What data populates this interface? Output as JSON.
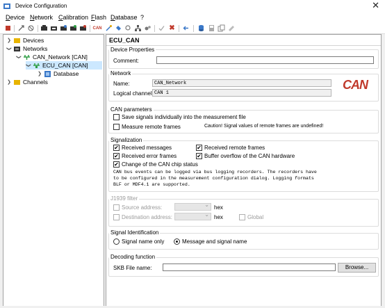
{
  "window": {
    "title": "Device Configuration",
    "close_glyph": "✕"
  },
  "menu": [
    "Device",
    "Network",
    "Calibration",
    "Flash",
    "Database",
    "?"
  ],
  "toolbar": {
    "icons": [
      "power-icon",
      "connect-icon",
      "disconnect-icon",
      "network-add-icon",
      "network-remove-icon",
      "bus-icon",
      "bus-add-icon",
      "bus-remove-icon",
      "can-icon",
      "wizard-icon",
      "ecu-icon",
      "search-icon",
      "tree-icon",
      "settings-icon",
      "check-icon",
      "delete-icon",
      "import-icon",
      "database-icon",
      "save-icon",
      "copy-icon",
      "help-icon"
    ],
    "can_label": "CAN"
  },
  "tree": {
    "devices": "Devices",
    "networks": "Networks",
    "can_network": "CAN_Network [CAN]",
    "ecu_can": "ECU_CAN [CAN]",
    "database": "Database",
    "channels": "Channels"
  },
  "panel": {
    "title": "ECU_CAN",
    "device_properties": {
      "label": "Device Properties",
      "comment_label": "Comment:",
      "comment_value": ""
    },
    "network": {
      "label": "Network",
      "name_label": "Name:",
      "name_value": "CAN_Network",
      "channel_label": "Logical channel:",
      "channel_value": "CAN 1",
      "logo_text": "CAN"
    },
    "can_parameters": {
      "label": "CAN parameters",
      "save_signals": "Save signals individually into the measurement file",
      "measure_remote": "Measure remote frames",
      "caution": "Caution! Signal values of remote frames are undefined!"
    },
    "signalization": {
      "label": "Signalization",
      "received_messages": "Received messages",
      "received_remote": "Received remote frames",
      "received_error": "Received error frames",
      "buffer_overflow": "Buffer overflow of the CAN hardware",
      "chip_status": "Change of the CAN chip status",
      "note_line1": "CAN bus events can be logged via bus logging recorders. The recorders have",
      "note_line2": "to be configured in the measurement configuration dialog. Logging formats",
      "note_line3": "BLF or MDF4.1 are supported."
    },
    "j1939": {
      "label": "J1939 filter",
      "source": "Source address:",
      "destination": "Destination address:",
      "hex1": "hex",
      "hex2": "hex",
      "global": "Global"
    },
    "signal_identification": {
      "label": "Signal Identification",
      "signal_only": "Signal name only",
      "message_and_signal": "Message and signal name"
    },
    "decoding": {
      "label": "Decoding function",
      "skb_label": "SKB File name:",
      "skb_value": "",
      "browse": "Browse..."
    }
  }
}
